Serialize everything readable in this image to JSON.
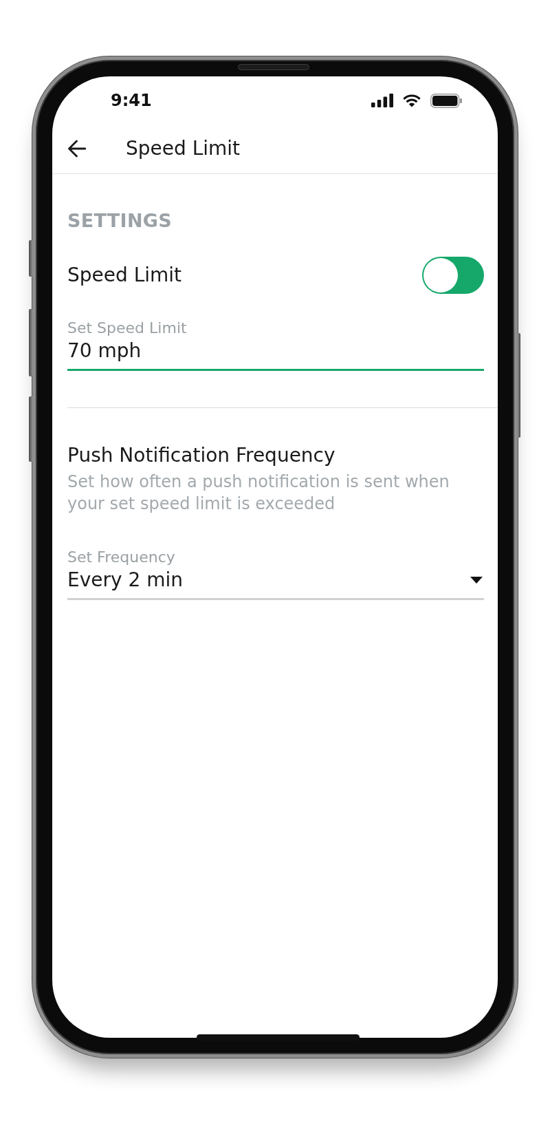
{
  "status_bar": {
    "time": "9:41"
  },
  "app_bar": {
    "title": "Speed Limit"
  },
  "settings": {
    "heading": "SETTINGS",
    "toggle": {
      "label": "Speed Limit",
      "on": true
    },
    "field": {
      "kind": "text",
      "label": "Set Speed Limit",
      "value": "70 mph",
      "focused": true
    }
  },
  "notifications": {
    "title": "Push Notification Frequency",
    "description": "Set how often a push notification is sent when your set speed limit is exceeded",
    "field": {
      "kind": "dropdown",
      "label": "Set Frequency",
      "value": "Every 2 min",
      "focused": false
    }
  }
}
